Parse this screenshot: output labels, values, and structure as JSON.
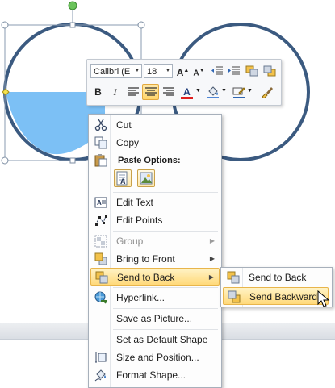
{
  "mini_toolbar": {
    "font_name": "Calibri (E",
    "font_size": "18",
    "buttons": [
      "grow-font",
      "shrink-font",
      "decrease-indent",
      "increase-indent",
      "bring-forward",
      "send-backward",
      "bold",
      "italic",
      "align-left",
      "center",
      "align-right",
      "font-color",
      "shape-fill",
      "shape-outline",
      "format-painter"
    ],
    "bold_label": "B",
    "italic_label": "I",
    "font_color_label": "A"
  },
  "context_menu": {
    "items": [
      {
        "label": "Cut",
        "icon": "scissors-icon"
      },
      {
        "label": "Copy",
        "icon": "copy-icon"
      },
      {
        "label": "Paste Options:",
        "icon": "paste-icon"
      },
      {
        "label": "Edit Text",
        "icon": "edit-text-icon"
      },
      {
        "label": "Edit Points",
        "icon": "edit-points-icon"
      },
      {
        "label": "Group",
        "icon": "group-icon",
        "disabled": true
      },
      {
        "label": "Bring to Front",
        "icon": "bring-to-front-icon"
      },
      {
        "label": "Send to Back",
        "icon": "send-to-back-icon",
        "highlighted": true
      },
      {
        "label": "Hyperlink...",
        "icon": "hyperlink-icon"
      },
      {
        "label": "Save as Picture..."
      },
      {
        "label": "Set as Default Shape"
      },
      {
        "label": "Size and Position...",
        "icon": "size-position-icon"
      },
      {
        "label": "Format Shape...",
        "icon": "format-shape-icon"
      }
    ]
  },
  "submenu": {
    "items": [
      {
        "label": "Send to Back",
        "icon": "send-to-back-icon"
      },
      {
        "label": "Send Backward",
        "icon": "send-backward-icon",
        "highlighted": true
      }
    ]
  },
  "colors": {
    "circle_outline": "#3b5a80",
    "fill": "#7cc0f5",
    "highlight": "#ffd97a"
  }
}
